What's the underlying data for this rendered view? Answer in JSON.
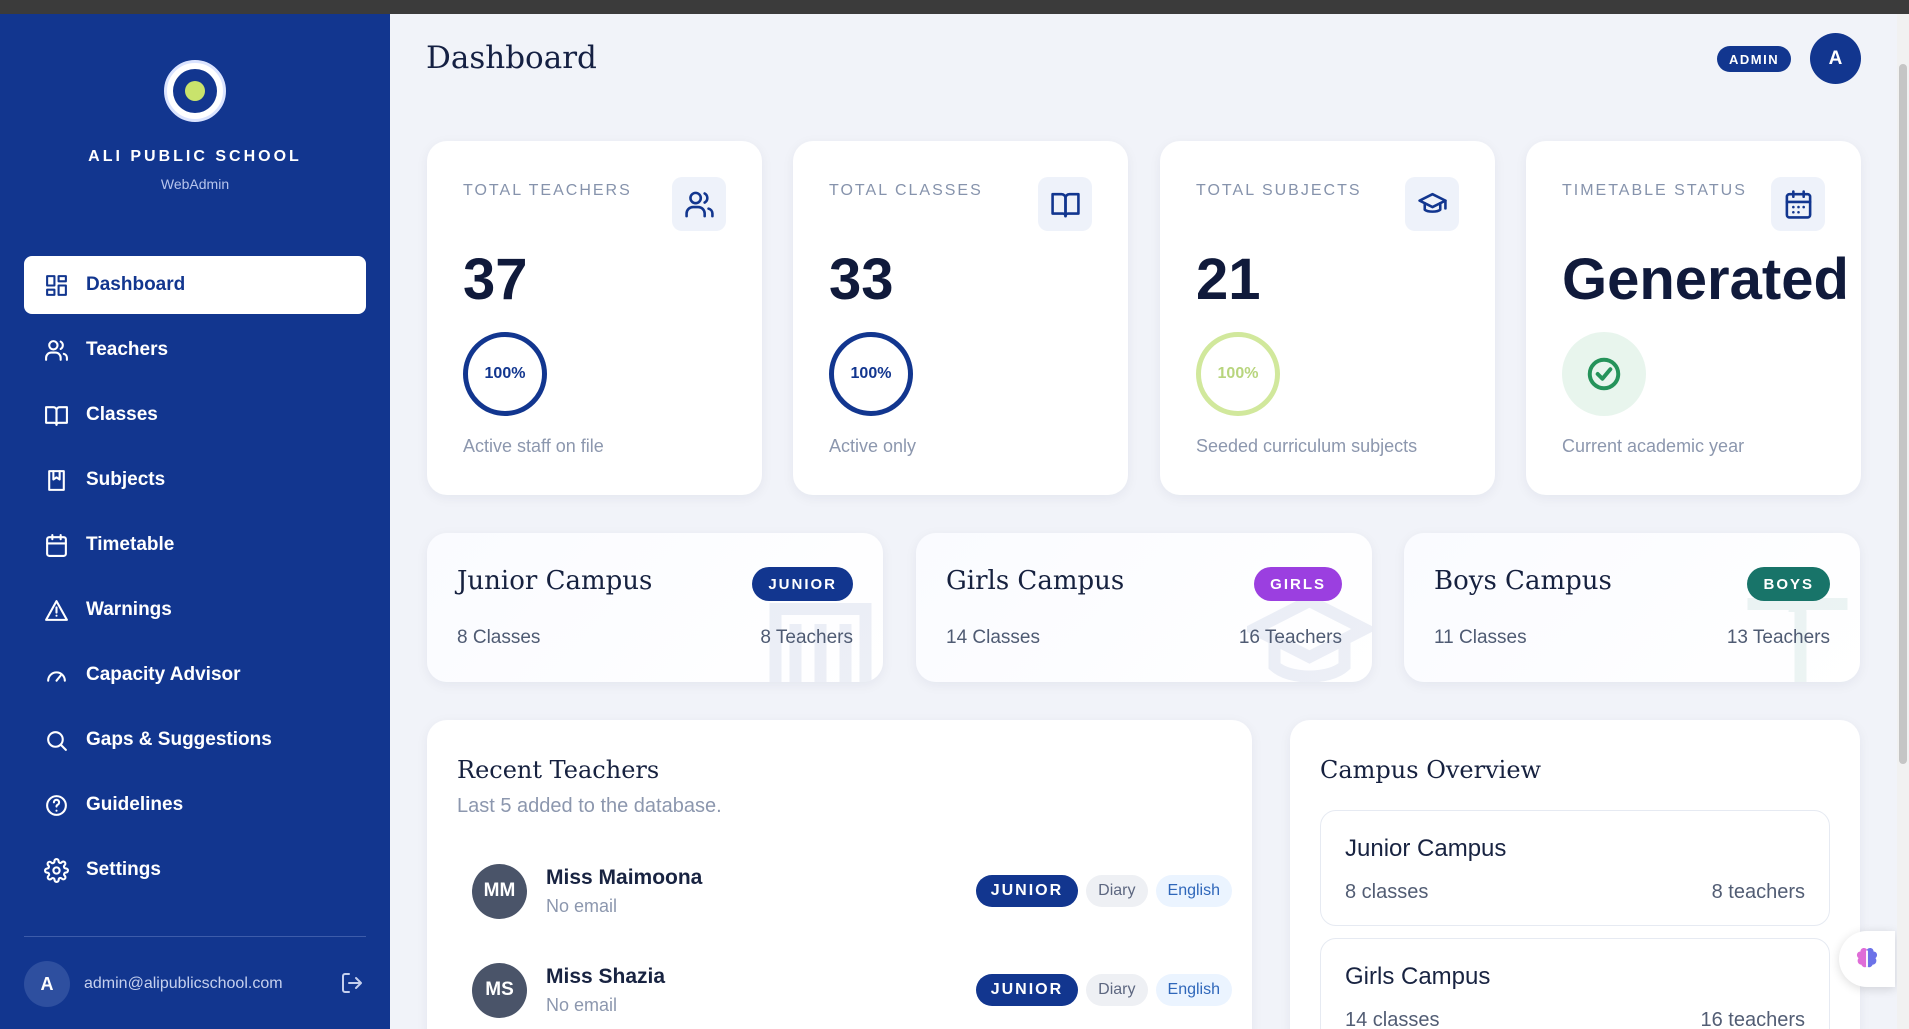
{
  "app": {
    "school_name": "ALI PUBLIC SCHOOL",
    "subtitle": "WebAdmin",
    "logo_icon": "school-crest-icon",
    "page_title": "Dashboard",
    "role_badge": "ADMIN",
    "user_initial": "A"
  },
  "sidebar": {
    "items": [
      {
        "label": "Dashboard",
        "icon": "dashboard-icon",
        "active": true
      },
      {
        "label": "Teachers",
        "icon": "teachers-icon"
      },
      {
        "label": "Classes",
        "icon": "book-open-icon"
      },
      {
        "label": "Subjects",
        "icon": "bookmark-book-icon"
      },
      {
        "label": "Timetable",
        "icon": "calendar-icon"
      },
      {
        "label": "Warnings",
        "icon": "warning-triangle-icon"
      },
      {
        "label": "Capacity Advisor",
        "icon": "gauge-icon"
      },
      {
        "label": "Gaps & Suggestions",
        "icon": "search-icon"
      },
      {
        "label": "Guidelines",
        "icon": "help-circle-icon"
      },
      {
        "label": "Settings",
        "icon": "settings-icon"
      }
    ],
    "footer": {
      "initial": "A",
      "email": "admin@alipublicschool.com",
      "logout_icon": "logout-icon"
    }
  },
  "stats": [
    {
      "label": "TOTAL TEACHERS",
      "value": "37",
      "progress": "100%",
      "progress_fraction": 1.0,
      "footnote": "Active staff on file",
      "icon": "teachers-icon",
      "ring_color": "#12368f"
    },
    {
      "label": "TOTAL CLASSES",
      "value": "33",
      "progress": "100%",
      "progress_fraction": 1.0,
      "footnote": "Active only",
      "icon": "book-open-icon",
      "ring_color": "#12368f"
    },
    {
      "label": "TOTAL SUBJECTS",
      "value": "21",
      "progress": "100%",
      "progress_fraction": 1.0,
      "footnote": "Seeded curriculum subjects",
      "icon": "graduation-cap-icon",
      "ring_color": "#d1e89c"
    },
    {
      "label": "TIMETABLE STATUS",
      "value": "Generated",
      "footnote": "Current academic year",
      "icon": "calendar-icon",
      "status_icon": "check-circle-icon"
    }
  ],
  "campuses": [
    {
      "name": "Junior Campus",
      "tag": "JUNIOR",
      "tag_color": "#12368f",
      "classes": "8 Classes",
      "teachers": "8 Teachers"
    },
    {
      "name": "Girls Campus",
      "tag": "GIRLS",
      "tag_color": "#9b3fe0",
      "classes": "14 Classes",
      "teachers": "16 Teachers"
    },
    {
      "name": "Boys Campus",
      "tag": "BOYS",
      "tag_color": "#187469",
      "classes": "11 Classes",
      "teachers": "13 Teachers"
    }
  ],
  "recent_teachers": {
    "title": "Recent Teachers",
    "subtitle": "Last 5 added to the database.",
    "items": [
      {
        "initials": "MM",
        "name": "Miss Maimoona",
        "email": "No email",
        "campus": "JUNIOR",
        "subjects": [
          "Diary",
          "English"
        ]
      },
      {
        "initials": "MS",
        "name": "Miss Shazia",
        "email": "No email",
        "campus": "JUNIOR",
        "subjects": [
          "Diary",
          "English"
        ]
      }
    ]
  },
  "campus_overview": {
    "title": "Campus Overview",
    "items": [
      {
        "name": "Junior Campus",
        "classes": "8 classes",
        "teachers": "8 teachers"
      },
      {
        "name": "Girls Campus",
        "classes": "14 classes",
        "teachers": "16 teachers"
      }
    ]
  },
  "floating_action": {
    "icon": "brain-icon"
  },
  "colors": {
    "sidebar": "#12368f",
    "accent": "#12368f",
    "background": "#f1f3f9"
  }
}
